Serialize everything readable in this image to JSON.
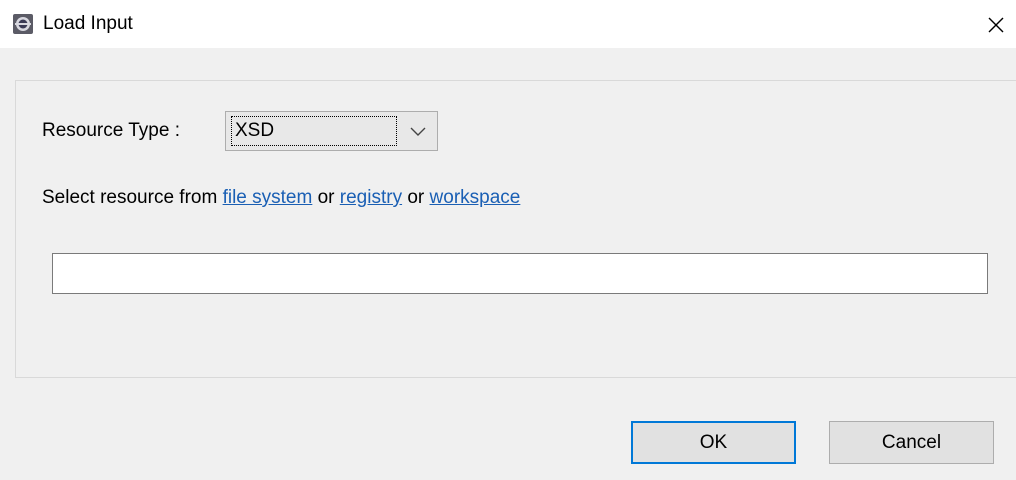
{
  "window": {
    "title": "Load Input",
    "icon": "eclipse-app-icon",
    "close_icon": "close-icon"
  },
  "form": {
    "resource_type_label": "Resource Type :",
    "resource_type_value": "XSD",
    "select_prefix": "Select resource from ",
    "link_file_system": "file system",
    "sep_or_1": " or ",
    "link_registry": "registry",
    "sep_or_2": " or ",
    "link_workspace": "workspace",
    "path_value": "",
    "path_placeholder": ""
  },
  "buttons": {
    "ok_label": "OK",
    "cancel_label": "Cancel"
  },
  "colors": {
    "link": "#1a5fb4",
    "default_button_border": "#0078d7",
    "background": "#f0f0f0"
  }
}
